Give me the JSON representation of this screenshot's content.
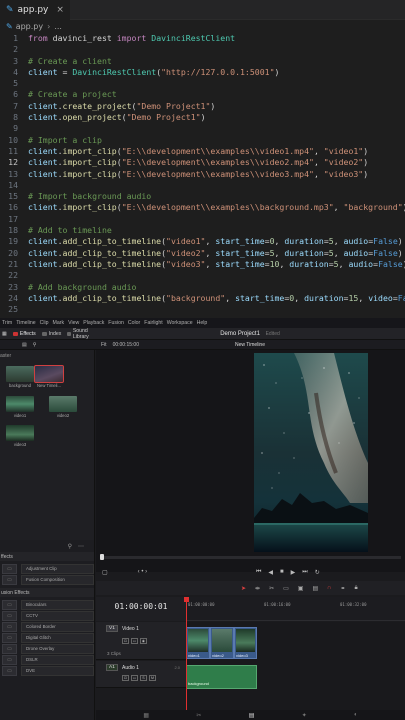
{
  "editor": {
    "tab": {
      "icon": "python-icon",
      "name": "app.py",
      "close": "×"
    },
    "breadcrumb": {
      "file": "app.py",
      "sep": "›",
      "rest": "..."
    },
    "lines": [
      {
        "n": "1",
        "parts": [
          [
            "kw",
            "from"
          ],
          [
            "op",
            " "
          ],
          [
            "txt",
            "davinci_rest"
          ],
          [
            "op",
            " "
          ],
          [
            "kw",
            "import"
          ],
          [
            "op",
            " "
          ],
          [
            "cls",
            "DavinciRestClient"
          ]
        ]
      },
      {
        "n": "2",
        "parts": []
      },
      {
        "n": "3",
        "parts": [
          [
            "cm",
            "# Create a client"
          ]
        ]
      },
      {
        "n": "4",
        "parts": [
          [
            "var",
            "client"
          ],
          [
            "op",
            " = "
          ],
          [
            "cls",
            "DavinciRestClient"
          ],
          [
            "op",
            "("
          ],
          [
            "str",
            "\"http://127.0.0.1:5001\""
          ],
          [
            "op",
            ")"
          ]
        ]
      },
      {
        "n": "5",
        "parts": []
      },
      {
        "n": "6",
        "parts": [
          [
            "cm",
            "# Create a project"
          ]
        ]
      },
      {
        "n": "7",
        "parts": [
          [
            "var",
            "client"
          ],
          [
            "op",
            "."
          ],
          [
            "fn",
            "create_project"
          ],
          [
            "op",
            "("
          ],
          [
            "str",
            "\"Demo Project1\""
          ],
          [
            "op",
            ")"
          ]
        ]
      },
      {
        "n": "8",
        "parts": [
          [
            "var",
            "client"
          ],
          [
            "op",
            "."
          ],
          [
            "fn",
            "open_project"
          ],
          [
            "op",
            "("
          ],
          [
            "str",
            "\"Demo Project1\""
          ],
          [
            "op",
            ")"
          ]
        ]
      },
      {
        "n": "9",
        "parts": []
      },
      {
        "n": "10",
        "parts": [
          [
            "cm",
            "# Import a clip"
          ]
        ]
      },
      {
        "n": "11",
        "parts": [
          [
            "var",
            "client"
          ],
          [
            "op",
            "."
          ],
          [
            "fn",
            "import_clip"
          ],
          [
            "op",
            "("
          ],
          [
            "str",
            "\"E:\\\\development\\\\examples\\\\video1.mp4\""
          ],
          [
            "op",
            ", "
          ],
          [
            "str",
            "\"video1\""
          ],
          [
            "op",
            ")"
          ]
        ]
      },
      {
        "n": "12",
        "active": true,
        "parts": [
          [
            "var",
            "client"
          ],
          [
            "op",
            "."
          ],
          [
            "fn",
            "import_clip"
          ],
          [
            "op",
            "("
          ],
          [
            "str",
            "\"E:\\\\development\\\\examples\\\\video2.mp4\""
          ],
          [
            "op",
            ", "
          ],
          [
            "str",
            "\"video2\""
          ],
          [
            "op",
            ")"
          ]
        ]
      },
      {
        "n": "13",
        "parts": [
          [
            "var",
            "client"
          ],
          [
            "op",
            "."
          ],
          [
            "fn",
            "import_clip"
          ],
          [
            "op",
            "("
          ],
          [
            "str",
            "\"E:\\\\development\\\\examples\\\\video3.mp4\""
          ],
          [
            "op",
            ", "
          ],
          [
            "str",
            "\"video3\""
          ],
          [
            "op",
            ")"
          ]
        ]
      },
      {
        "n": "14",
        "parts": []
      },
      {
        "n": "15",
        "parts": [
          [
            "cm",
            "# Import background audio"
          ]
        ]
      },
      {
        "n": "16",
        "parts": [
          [
            "var",
            "client"
          ],
          [
            "op",
            "."
          ],
          [
            "fn",
            "import_clip"
          ],
          [
            "op",
            "("
          ],
          [
            "str",
            "\"E:\\\\development\\\\examples\\\\background.mp3\""
          ],
          [
            "op",
            ", "
          ],
          [
            "str",
            "\"background\""
          ],
          [
            "op",
            ")"
          ]
        ]
      },
      {
        "n": "17",
        "parts": []
      },
      {
        "n": "18",
        "parts": [
          [
            "cm",
            "# Add to timeline"
          ]
        ]
      },
      {
        "n": "19",
        "parts": [
          [
            "var",
            "client"
          ],
          [
            "op",
            "."
          ],
          [
            "fn",
            "add_clip_to_timeline"
          ],
          [
            "op",
            "("
          ],
          [
            "str",
            "\"video1\""
          ],
          [
            "op",
            ", "
          ],
          [
            "var",
            "start_time"
          ],
          [
            "op",
            "="
          ],
          [
            "num",
            "0"
          ],
          [
            "op",
            ", "
          ],
          [
            "var",
            "duration"
          ],
          [
            "op",
            "="
          ],
          [
            "num",
            "5"
          ],
          [
            "op",
            ", "
          ],
          [
            "var",
            "audio"
          ],
          [
            "op",
            "="
          ],
          [
            "bool",
            "False"
          ],
          [
            "op",
            ")"
          ]
        ]
      },
      {
        "n": "20",
        "parts": [
          [
            "var",
            "client"
          ],
          [
            "op",
            "."
          ],
          [
            "fn",
            "add_clip_to_timeline"
          ],
          [
            "op",
            "("
          ],
          [
            "str",
            "\"video2\""
          ],
          [
            "op",
            ", "
          ],
          [
            "var",
            "start_time"
          ],
          [
            "op",
            "="
          ],
          [
            "num",
            "5"
          ],
          [
            "op",
            ", "
          ],
          [
            "var",
            "duration"
          ],
          [
            "op",
            "="
          ],
          [
            "num",
            "5"
          ],
          [
            "op",
            ", "
          ],
          [
            "var",
            "audio"
          ],
          [
            "op",
            "="
          ],
          [
            "bool",
            "False"
          ],
          [
            "op",
            ")"
          ]
        ]
      },
      {
        "n": "21",
        "parts": [
          [
            "var",
            "client"
          ],
          [
            "op",
            "."
          ],
          [
            "fn",
            "add_clip_to_timeline"
          ],
          [
            "op",
            "("
          ],
          [
            "str",
            "\"video3\""
          ],
          [
            "op",
            ", "
          ],
          [
            "var",
            "start_time"
          ],
          [
            "op",
            "="
          ],
          [
            "num",
            "10"
          ],
          [
            "op",
            ", "
          ],
          [
            "var",
            "duration"
          ],
          [
            "op",
            "="
          ],
          [
            "num",
            "5"
          ],
          [
            "op",
            ", "
          ],
          [
            "var",
            "audio"
          ],
          [
            "op",
            "="
          ],
          [
            "bool",
            "False"
          ],
          [
            "op",
            ")"
          ]
        ]
      },
      {
        "n": "22",
        "parts": []
      },
      {
        "n": "23",
        "parts": [
          [
            "cm",
            "# Add background audio"
          ]
        ]
      },
      {
        "n": "24",
        "parts": [
          [
            "var",
            "client"
          ],
          [
            "op",
            "."
          ],
          [
            "fn",
            "add_clip_to_timeline"
          ],
          [
            "op",
            "("
          ],
          [
            "str",
            "\"background\""
          ],
          [
            "op",
            ", "
          ],
          [
            "var",
            "start_time"
          ],
          [
            "op",
            "="
          ],
          [
            "num",
            "0"
          ],
          [
            "op",
            ", "
          ],
          [
            "var",
            "duration"
          ],
          [
            "op",
            "="
          ],
          [
            "num",
            "15"
          ],
          [
            "op",
            ", "
          ],
          [
            "var",
            "video"
          ],
          [
            "op",
            "="
          ],
          [
            "bool",
            "False"
          ],
          [
            "op",
            ")"
          ]
        ]
      },
      {
        "n": "25",
        "parts": []
      }
    ]
  },
  "resolve": {
    "menu": [
      "Trim",
      "Timeline",
      "Clip",
      "Mark",
      "View",
      "Playback",
      "Fusion",
      "Color",
      "Fairlight",
      "Workspace",
      "Help"
    ],
    "toolbar": {
      "effects": "Effects",
      "index": "Index",
      "sound_library": "Sound Library"
    },
    "project_title": "Demo Project1",
    "project_status": "Edited",
    "viewer_zoom": "Fit",
    "viewer_timecode": "00:00:15:00",
    "timeline_name": "New Timeline",
    "media_pool": {
      "label": "aster",
      "clips": [
        {
          "name": "background",
          "thumb": "th-bg",
          "selected": false
        },
        {
          "name": "New Timeli...",
          "thumb": "th-tl",
          "selected": true
        },
        {
          "name": "video1",
          "thumb": "th-v1",
          "selected": false
        },
        {
          "name": "video2",
          "thumb": "th-v2",
          "selected": false
        },
        {
          "name": "video3",
          "thumb": "th-v3",
          "selected": false
        }
      ]
    },
    "effects": {
      "section1": "ffects",
      "items1": [
        "Adjustment Clip",
        "Fusion Composition"
      ],
      "section2": "usion Effects",
      "items2": [
        "Binoculars",
        "CCTV",
        "Colored Border",
        "Digital Glitch",
        "Drone Overlay",
        "DSLR",
        "DVE"
      ]
    },
    "timeline": {
      "timecode": "01:00:00:01",
      "ruler": [
        "01:00:00:00",
        "01:00:16:00",
        "01:00:32:00"
      ],
      "tracks": {
        "video": {
          "badge": "V1",
          "name": "Video 1",
          "count": "3 Clips"
        },
        "audio": {
          "badge": "A1",
          "name": "Audio 1",
          "level": "2.0"
        }
      },
      "video_clips": [
        "video1",
        "video2",
        "video3"
      ],
      "audio_clip": "background"
    },
    "accent": "#e03030"
  }
}
